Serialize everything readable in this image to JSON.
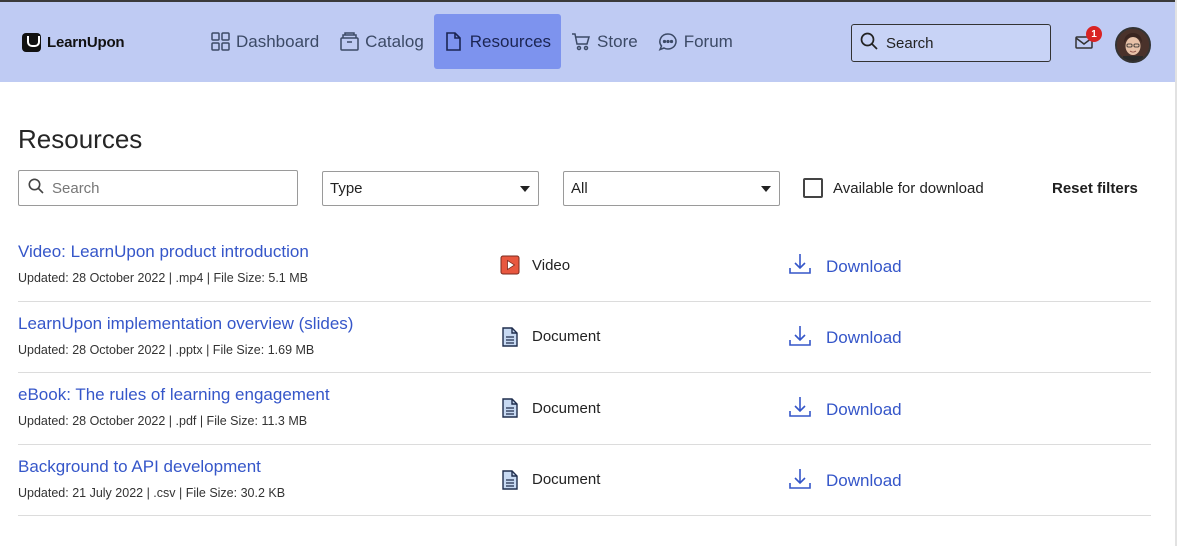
{
  "header": {
    "logo_text": "LearnUpon",
    "nav": [
      {
        "label": "Dashboard",
        "icon": "dashboard-grid-icon",
        "active": false
      },
      {
        "label": "Catalog",
        "icon": "catalog-icon",
        "active": false
      },
      {
        "label": "Resources",
        "icon": "document-icon",
        "active": true
      },
      {
        "label": "Store",
        "icon": "cart-icon",
        "active": false
      },
      {
        "label": "Forum",
        "icon": "chat-bubble-icon",
        "active": false
      }
    ],
    "search_placeholder": "Search",
    "notifications_count": "1",
    "colors": {
      "header_bg": "#bfcbf3",
      "active_nav_bg": "#7d93ee",
      "badge": "#d92323"
    }
  },
  "main": {
    "title": "Resources",
    "filters": {
      "search_placeholder": "Search",
      "type_select": "Type",
      "scope_select": "All",
      "available_label": "Available for download",
      "available_checked": false,
      "reset_label": "Reset filters"
    },
    "resources": [
      {
        "title": "Video: LearnUpon product introduction",
        "meta": "Updated: 28 October 2022 | .mp4 | File Size: 5.1 MB",
        "type": "Video",
        "type_icon": "video-icon",
        "action": "Download"
      },
      {
        "title": "LearnUpon implementation overview (slides)",
        "meta": "Updated: 28 October 2022 | .pptx | File Size: 1.69 MB",
        "type": "Document",
        "type_icon": "document-icon",
        "action": "Download"
      },
      {
        "title": "eBook: The rules of learning engagement",
        "meta": "Updated: 28 October 2022 | .pdf | File Size: 11.3 MB",
        "type": "Document",
        "type_icon": "document-icon",
        "action": "Download"
      },
      {
        "title": "Background to API development",
        "meta": "Updated: 21 July 2022 | .csv | File Size: 30.2 KB",
        "type": "Document",
        "type_icon": "document-icon",
        "action": "Download"
      }
    ],
    "colors": {
      "link": "#3556c9",
      "video_icon": "#e8573f"
    }
  }
}
